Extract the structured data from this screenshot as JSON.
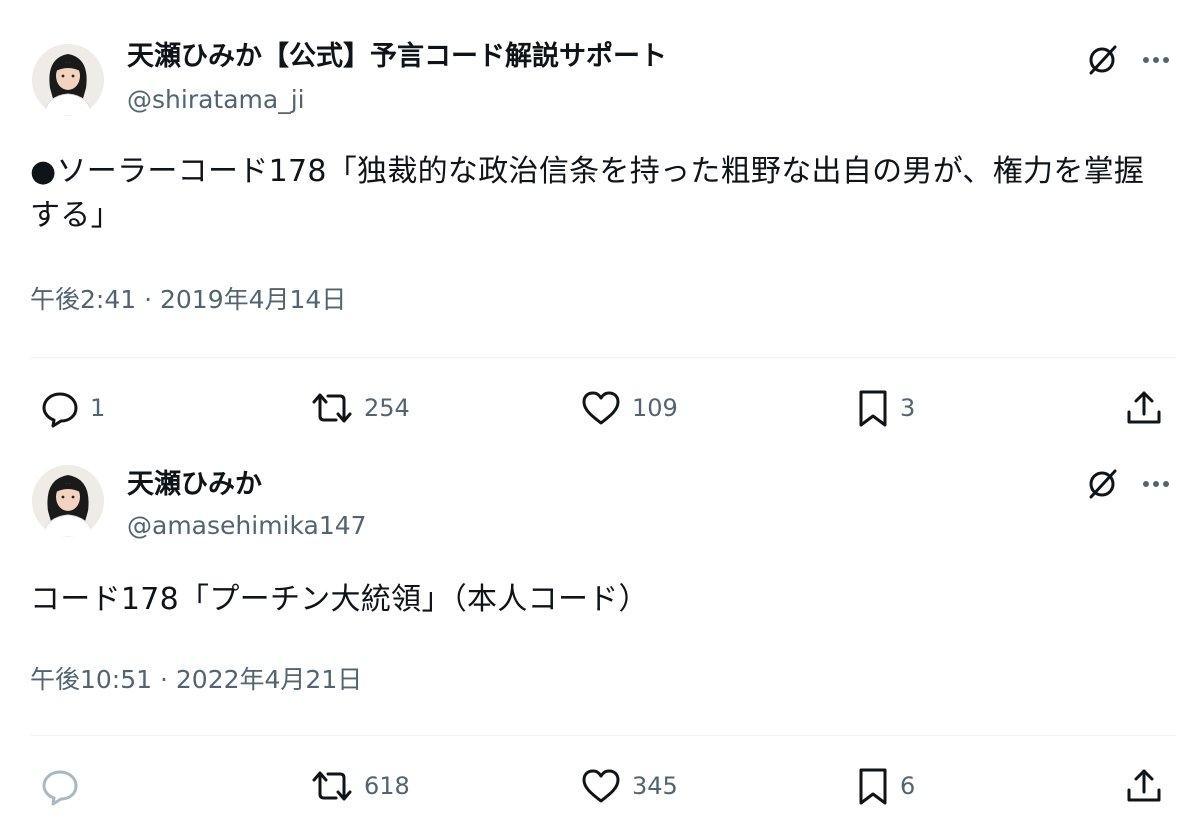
{
  "tweets": [
    {
      "display_name": "天瀬ひみか【公式】予言コード解説サポート",
      "handle": "@shiratama_ji",
      "text": "●ソーラーコード178「独裁的な政治信条を持った粗野な出自の男が、権力を掌握する」",
      "timestamp": "午後2:41 · 2019年4月14日",
      "reply_count": "1",
      "retweet_count": "254",
      "like_count": "109",
      "bookmark_count": "3"
    },
    {
      "display_name": "天瀬ひみか",
      "handle": "@amasehimika147",
      "text": "コード178「プーチン大統領」（本人コード）",
      "timestamp": "午後10:51 · 2022年4月21日",
      "reply_count": "",
      "retweet_count": "618",
      "like_count": "345",
      "bookmark_count": "6"
    }
  ],
  "icons": {
    "avatar": "avatar-photo",
    "grok": "grok-icon",
    "more": "more-icon",
    "reply": "reply-icon",
    "retweet": "retweet-icon",
    "like": "heart-icon",
    "bookmark": "bookmark-icon",
    "share": "share-icon"
  },
  "colors": {
    "text_primary": "#0f1419",
    "text_secondary": "#536471",
    "divider": "#eff3f4",
    "background": "#ffffff"
  }
}
